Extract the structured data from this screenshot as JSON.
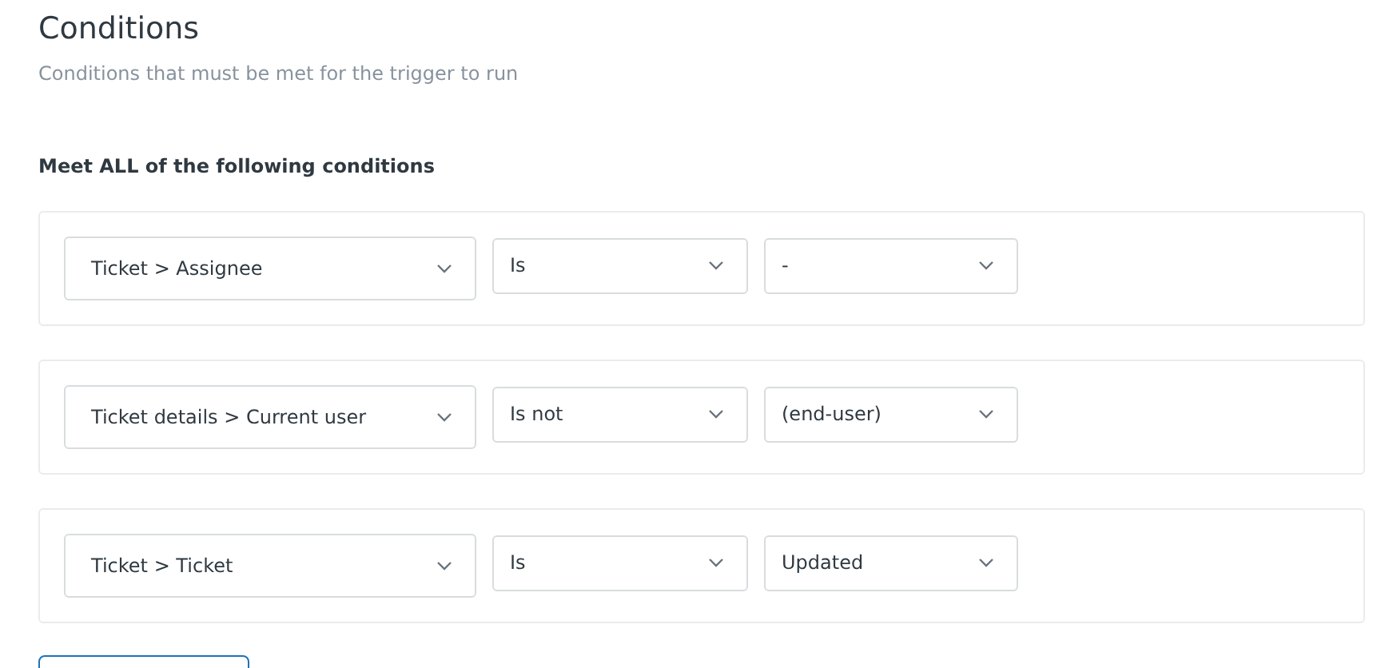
{
  "title": "Conditions",
  "subtitle": "Conditions that must be met for the trigger to run",
  "group_heading": "Meet ALL of the following conditions",
  "conditions": [
    {
      "field": "Ticket > Assignee",
      "operator": "Is",
      "value": "-"
    },
    {
      "field": "Ticket details > Current user",
      "operator": "Is not",
      "value": "(end-user)"
    },
    {
      "field": "Ticket > Ticket",
      "operator": "Is",
      "value": "Updated"
    }
  ]
}
